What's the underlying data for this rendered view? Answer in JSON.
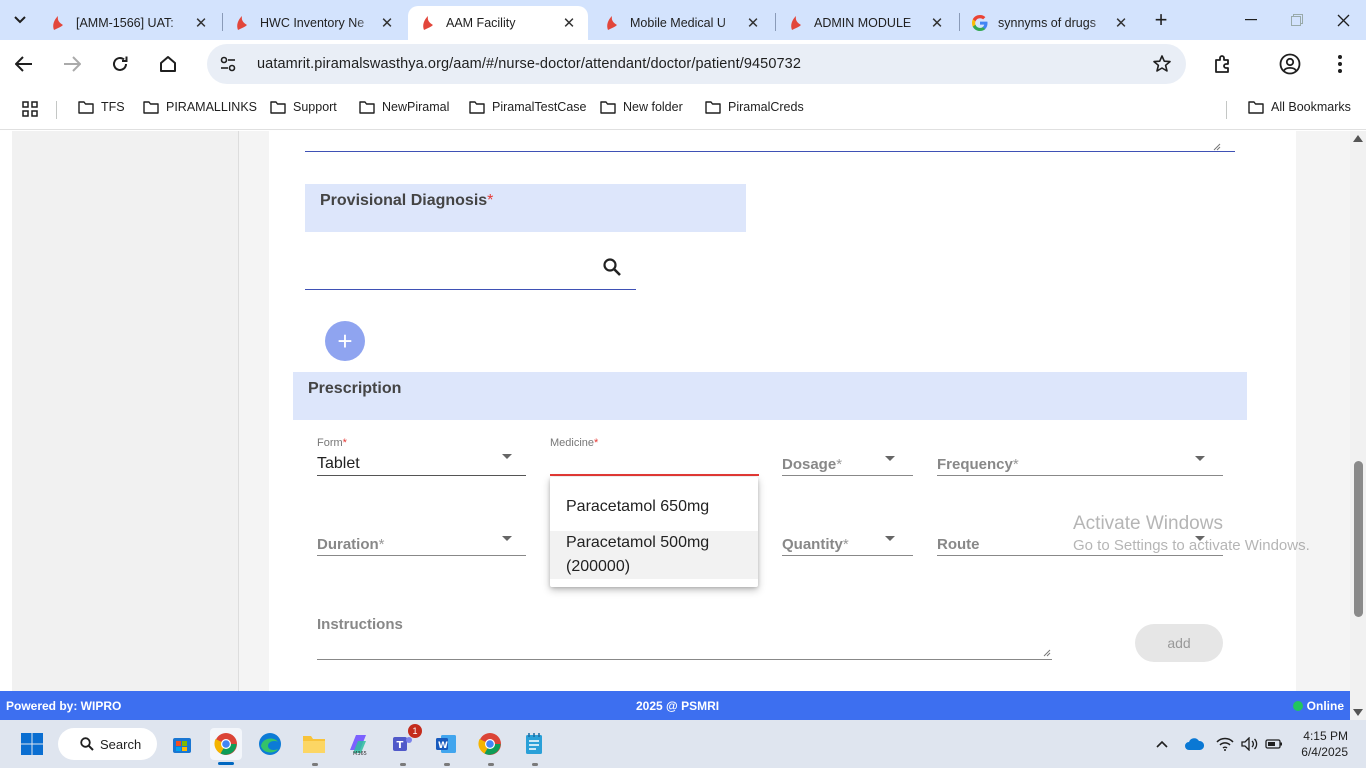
{
  "browser": {
    "tabs": [
      {
        "title": "[AMM-1566] UAT:",
        "favicon": "piramal-logo"
      },
      {
        "title": "HWC Inventory Ne",
        "favicon": "piramal-logo"
      },
      {
        "title": "AAM Facility",
        "favicon": "piramal-logo",
        "active": true
      },
      {
        "title": "Mobile Medical U",
        "favicon": "piramal-logo"
      },
      {
        "title": "ADMIN MODULE",
        "favicon": "piramal-logo"
      },
      {
        "title": "synnyms of drugs",
        "favicon": "google-logo"
      }
    ],
    "url": "uatamrit.piramalswasthya.org/aam/#/nurse-doctor/attendant/doctor/patient/9450732",
    "bookmarks": [
      "TFS",
      "PIRAMALLINKS",
      "Support",
      "NewPiramal",
      "PiramalTestCase",
      "New folder",
      "PiramalCreds"
    ],
    "all_bookmarks": "All Bookmarks"
  },
  "page": {
    "provisional_diagnosis": {
      "title": "Provisional Diagnosis",
      "required_mark": "*"
    },
    "prescription": {
      "title": "Prescription",
      "form": {
        "label": "Form",
        "value": "Tablet"
      },
      "medicine": {
        "label": "Medicine"
      },
      "dosage": {
        "label": "Dosage"
      },
      "frequency": {
        "label": "Frequency"
      },
      "duration": {
        "label": "Duration"
      },
      "quantity": {
        "label": "Quantity"
      },
      "route": {
        "label": "Route"
      },
      "instructions": {
        "label": "Instructions"
      },
      "required_mark": "*",
      "add_label": "add"
    },
    "medicine_options": [
      "Paracetamol 650mg",
      "Paracetamol 500mg (200000)"
    ]
  },
  "watermark": {
    "line1": "Activate Windows",
    "line2": "Go to Settings to activate Windows."
  },
  "footer": {
    "left": "Powered by: WIPRO",
    "center": "2025 @ PSMRI",
    "status": "Online"
  },
  "taskbar": {
    "search_label": "Search",
    "time": "4:15 PM",
    "date": "6/4/2025",
    "teams_badge": "1"
  },
  "colors": {
    "accent": "#3f51b5",
    "section_bg": "#dde6fb",
    "footer_bg": "#3d6ff0",
    "error": "#e53935"
  }
}
